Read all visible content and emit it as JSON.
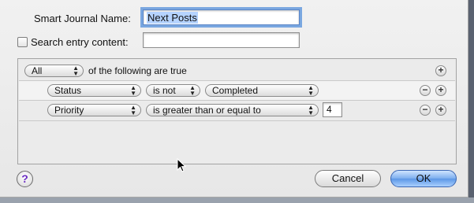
{
  "form": {
    "name_label": "Smart Journal Name:",
    "name_value": "Next Posts",
    "search_label": "Search entry content:",
    "search_value": ""
  },
  "criteria": {
    "match_value": "All",
    "match_suffix": "of the following are true",
    "rules": [
      {
        "field": "Status",
        "operator": "is not",
        "value": "Completed"
      },
      {
        "field": "Priority",
        "operator": "is greater than or equal to",
        "value": "4"
      }
    ]
  },
  "buttons": {
    "help": "?",
    "cancel": "Cancel",
    "ok": "OK"
  },
  "colors": {
    "focus_ring": "#7aa7e0",
    "default_button": "#5c97e6",
    "help_icon": "#6a2cc2"
  }
}
